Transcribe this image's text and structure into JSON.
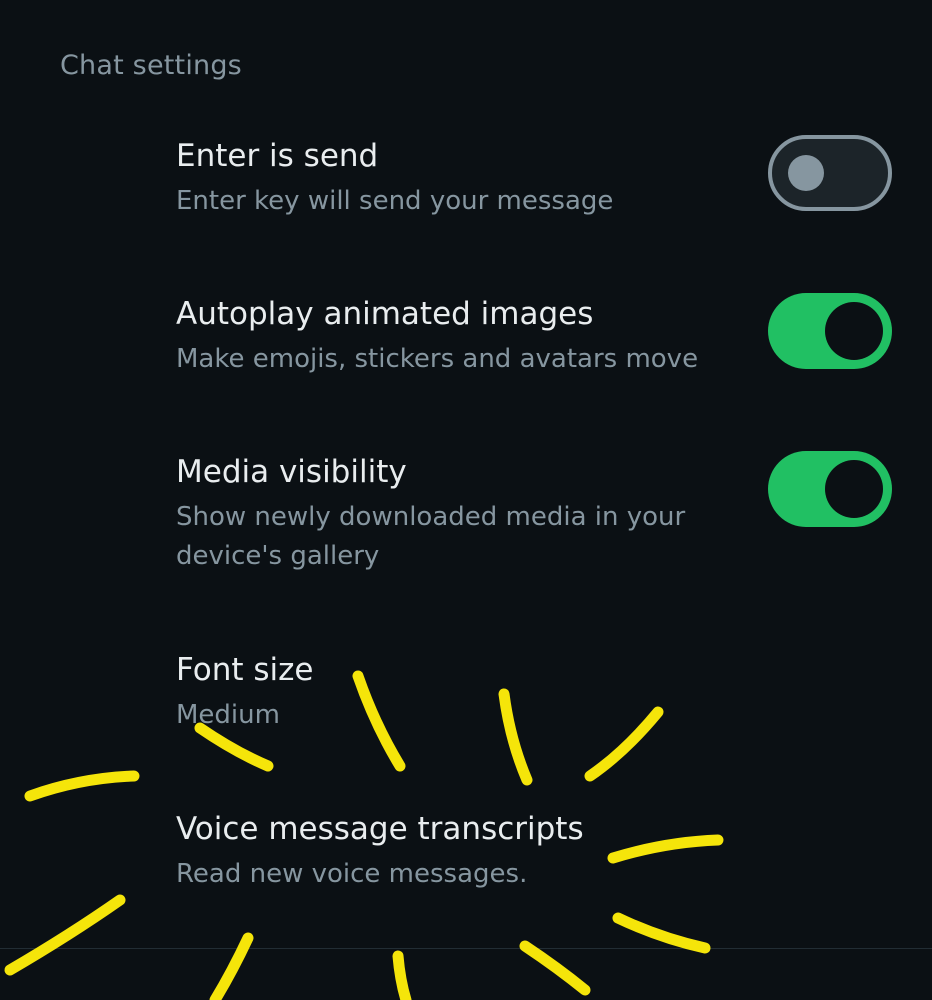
{
  "section": {
    "title": "Chat settings"
  },
  "settings": [
    {
      "title": "Enter is send",
      "description": "Enter key will send your message",
      "toggle": "off"
    },
    {
      "title": "Autoplay animated images",
      "description": "Make emojis, stickers and avatars move",
      "toggle": "on"
    },
    {
      "title": "Media visibility",
      "description": "Show newly downloaded media in your device's gallery",
      "toggle": "on"
    },
    {
      "title": "Font size",
      "description": "Medium"
    },
    {
      "title": "Voice message transcripts",
      "description": "Read new voice messages."
    }
  ],
  "colors": {
    "background": "#0b1014",
    "primary_text": "#e9edef",
    "secondary_text": "#8696a0",
    "toggle_on": "#21c063",
    "scribble": "#f5e50a"
  },
  "icons": {
    "toggle_off": "toggle-off-icon",
    "toggle_on": "toggle-on-icon"
  }
}
